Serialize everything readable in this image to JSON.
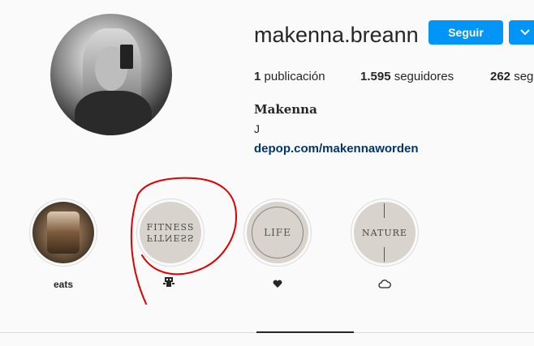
{
  "profile": {
    "username": "makenna.breann",
    "follow_label": "Seguir",
    "posts_count": "1",
    "posts_label": "publicación",
    "followers_count": "1.595",
    "followers_label": "seguidores",
    "following_count": "262",
    "following_label": "seg",
    "full_name": "Makenna",
    "bio": "J",
    "website": "depop.com/makennaworden"
  },
  "highlights": [
    {
      "label": "eats",
      "cover": "photo-drink"
    },
    {
      "label": "",
      "icon": "robot-icon",
      "cover_text": "FITNESS",
      "cover_text_mirror": "FITNESS"
    },
    {
      "label": "",
      "icon": "heart-icon",
      "cover_text": "LIFE"
    },
    {
      "label": "",
      "icon": "cloud-icon",
      "cover_text": "NATURE"
    }
  ],
  "colors": {
    "accent": "#0095f6",
    "link": "#00376b",
    "annotation": "#e00000",
    "highlight_bg": "#d8d3cc"
  }
}
